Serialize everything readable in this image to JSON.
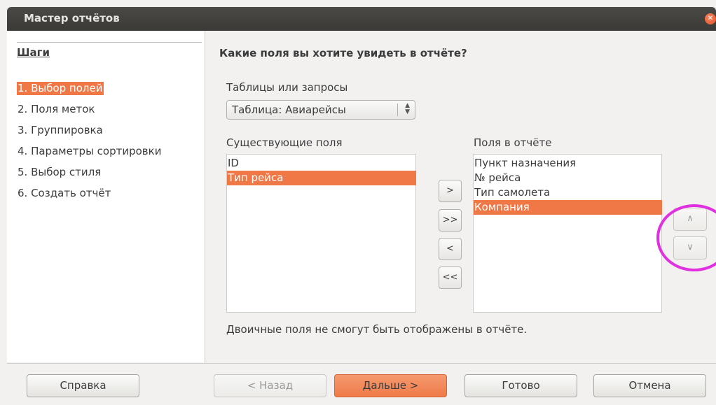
{
  "window": {
    "title": "Мастер отчётов",
    "close_icon": "close-icon"
  },
  "steps": {
    "header": "Шаги",
    "items": [
      {
        "label": "1. Выбор полей",
        "active": true
      },
      {
        "label": "2. Поля меток",
        "active": false
      },
      {
        "label": "3. Группировка",
        "active": false
      },
      {
        "label": "4. Параметры сортировки",
        "active": false
      },
      {
        "label": "5. Выбор стиля",
        "active": false
      },
      {
        "label": "6. Создать отчёт",
        "active": false
      }
    ]
  },
  "main": {
    "question": "Какие поля вы хотите увидеть в отчёте?",
    "tables_label": "Таблицы или запросы",
    "table_select_value": "Таблица: Авиарейсы",
    "existing_fields_label": "Существующие поля",
    "existing_fields": [
      {
        "label": "ID",
        "selected": false
      },
      {
        "label": "Тип рейса",
        "selected": true
      }
    ],
    "report_fields_label": "Поля в отчёте",
    "report_fields": [
      {
        "label": "Пункт назначения",
        "selected": false
      },
      {
        "label": "№ рейса",
        "selected": false
      },
      {
        "label": "Тип самолета",
        "selected": false
      },
      {
        "label": "Компания",
        "selected": true
      }
    ],
    "move_buttons": {
      "add": ">",
      "add_all": ">>",
      "remove": "<",
      "remove_all": "<<"
    },
    "order_buttons": {
      "up": "∧",
      "down": "∨"
    },
    "note": "Двоичные поля не смогут быть отображены в отчёте."
  },
  "footer": {
    "help": "Справка",
    "back": "< Назад",
    "next": "Дальше >",
    "finish": "Готово",
    "cancel": "Отмена"
  },
  "colors": {
    "selection": "#f07746",
    "highlight_circle": "#e030e0",
    "titlebar": "#3b3a36"
  }
}
